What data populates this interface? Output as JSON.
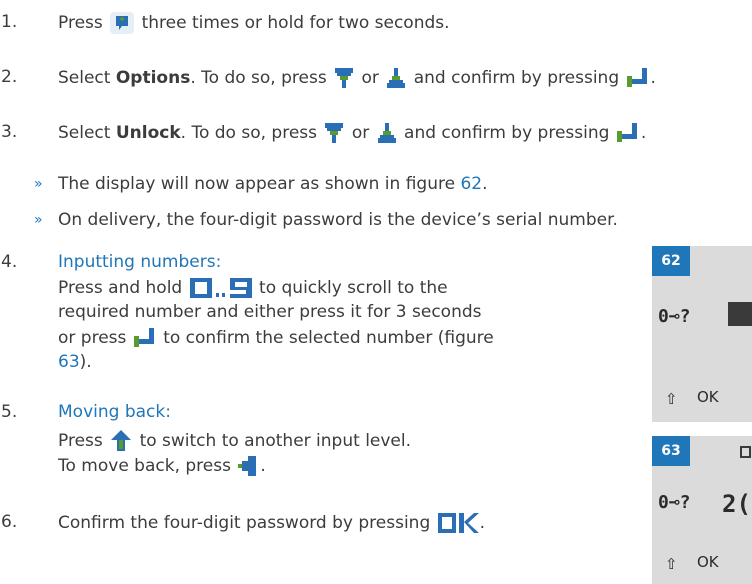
{
  "steps": [
    {
      "num": "1.",
      "pre": "Press",
      "post": "three times or hold for two seconds."
    },
    {
      "num": "2.",
      "select": "Select",
      "bold": "Options",
      "mid": ". To do so, press",
      "or": "or",
      "confirm": "and confirm by pressing",
      "end": "."
    },
    {
      "num": "3.",
      "select": "Select",
      "bold": "Unlock",
      "mid": ". To do so, press",
      "or": "or",
      "confirm": "and confirm by pressing",
      "end": "."
    }
  ],
  "notes": [
    {
      "bullet": "»",
      "pre": "The display will now appear as shown in figure",
      "link": "62",
      "end": "."
    },
    {
      "bullet": "»",
      "text": "On delivery, the four-digit password is the device’s serial number."
    }
  ],
  "step4": {
    "num": "4.",
    "heading": "Inputting numbers:",
    "line1_pre": "Press and hold",
    "line1_post": "to quickly scroll to the",
    "line2": "required number and either press it for 3 seconds",
    "line3_pre": "or press",
    "line3_post": "to confirm the selected number (figure",
    "line4_link": "63",
    "line4_end": ")."
  },
  "step5": {
    "num": "5.",
    "heading": "Moving back:",
    "line1_pre": "Press",
    "line1_post": "to switch to another input level.",
    "line2_pre": "To move back, press",
    "line2_end": "."
  },
  "step6": {
    "num": "6.",
    "pre": "Confirm the four-digit password by pressing",
    "end": "."
  },
  "figures": [
    {
      "badge": "62",
      "key_symbol": "0⊸?",
      "ok": "OK",
      "arrow": "⇧"
    },
    {
      "badge": "63",
      "key_symbol": "0⊸?",
      "value": "2(",
      "ok": "OK",
      "arrow": "⇧"
    }
  ],
  "colors": {
    "accent": "#1f76b8",
    "icon_blue": "#2a6fb5",
    "icon_green": "#5a9b2d",
    "panel": "#dbdbdb"
  }
}
